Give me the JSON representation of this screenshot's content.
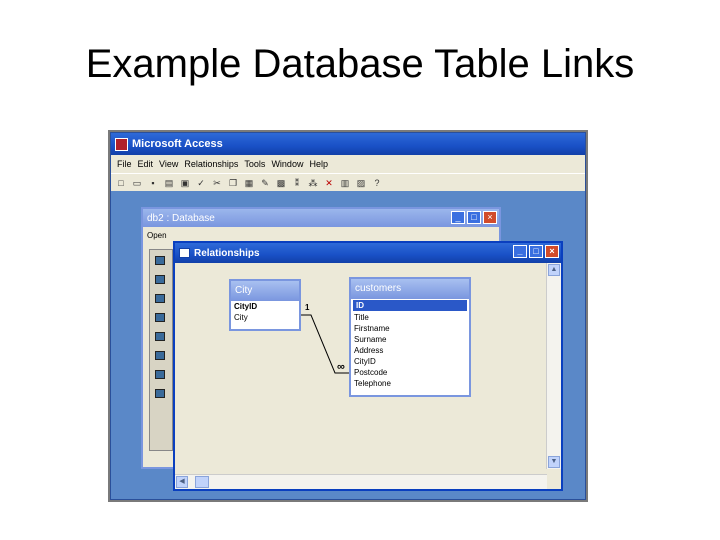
{
  "slide": {
    "title": "Example Database Table Links"
  },
  "app": {
    "title": "Microsoft Access",
    "menu": [
      "File",
      "Edit",
      "View",
      "Relationships",
      "Tools",
      "Window",
      "Help"
    ]
  },
  "db_window": {
    "title": "db2 : Database",
    "toolbar_open": "Open"
  },
  "relationships_window": {
    "title": "Relationships"
  },
  "tables": {
    "city": {
      "name": "City",
      "fields": [
        "CityID",
        "City"
      ]
    },
    "customers": {
      "name": "customers",
      "fields": [
        "ID",
        "Title",
        "Firstname",
        "Surname",
        "Address",
        "CityID",
        "Postcode",
        "Telephone"
      ]
    }
  },
  "relationship": {
    "one_label": "1",
    "many_label": "∞"
  },
  "colors": {
    "xp_title": "#1950c6",
    "face": "#ece9d8",
    "mdi": "#5a88c8",
    "table_header": "#7a96df"
  }
}
